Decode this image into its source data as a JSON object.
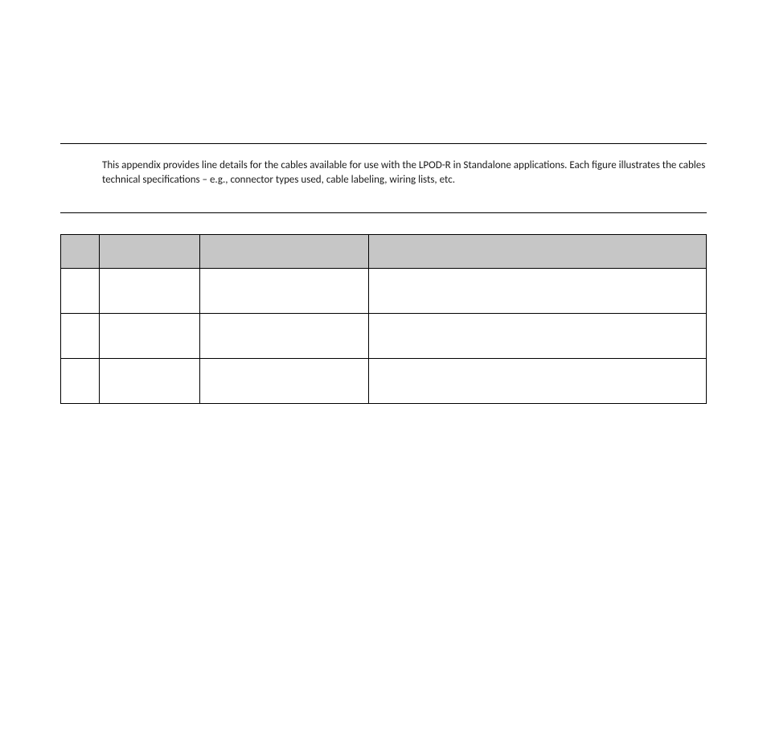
{
  "intro_text": "This appendix provides line details for the cables available for use with the LPOD-R in Standalone applications. Each figure illustrates the cables technical specifications – e.g., connector types used, cable labeling, wiring lists, etc.",
  "table": {
    "headers": {
      "fig": "",
      "part": "",
      "ref": "",
      "desc": ""
    },
    "rows": [
      {
        "fig": "",
        "part": "",
        "ref": "",
        "desc": ""
      },
      {
        "fig": "",
        "part": "",
        "ref": "",
        "desc": ""
      },
      {
        "fig": "",
        "part": "",
        "ref": "",
        "desc": ""
      }
    ]
  }
}
